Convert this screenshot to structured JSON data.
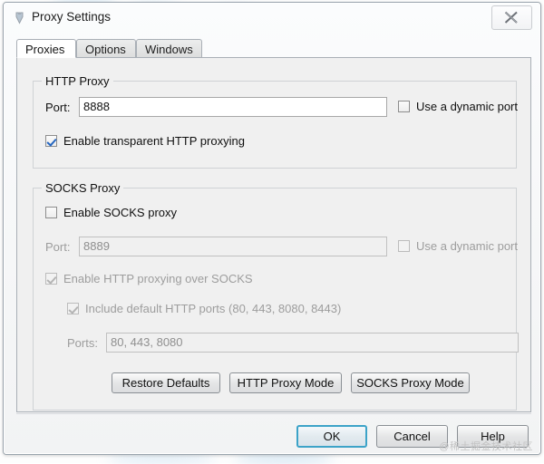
{
  "window": {
    "title": "Proxy Settings",
    "title_icon": "app-icon",
    "close_label": "✕"
  },
  "tabs": [
    {
      "label": "Proxies",
      "active": true
    },
    {
      "label": "Options",
      "active": false
    },
    {
      "label": "Windows",
      "active": false
    }
  ],
  "http_proxy": {
    "group_title": "HTTP Proxy",
    "port_label": "Port:",
    "port_value": "8888",
    "dynamic_port_label": "Use a dynamic port",
    "dynamic_port_checked": false,
    "transparent_label": "Enable transparent HTTP proxying",
    "transparent_checked": true
  },
  "socks_proxy": {
    "group_title": "SOCKS Proxy",
    "enable_label": "Enable SOCKS proxy",
    "enable_checked": false,
    "port_label": "Port:",
    "port_value": "8889",
    "dynamic_port_label": "Use a dynamic port",
    "dynamic_port_checked": false,
    "http_over_socks_label": "Enable HTTP proxying over SOCKS",
    "http_over_socks_checked": true,
    "default_ports_label": "Include default HTTP ports (80, 443, 8080, 8443)",
    "default_ports_checked": true,
    "ports_label": "Ports:",
    "ports_value": "80, 443, 8080"
  },
  "mode_buttons": {
    "restore_defaults": "Restore Defaults",
    "http_proxy_mode": "HTTP Proxy Mode",
    "socks_proxy_mode": "SOCKS Proxy Mode"
  },
  "dialog_buttons": {
    "ok": "OK",
    "cancel": "Cancel",
    "help": "Help"
  },
  "watermark": "@稀土掘金技术社区",
  "colors": {
    "accent": "#3ca3c8",
    "check": "#2566c0",
    "panel": "#f0f0f0",
    "border": "#a9afb6"
  }
}
